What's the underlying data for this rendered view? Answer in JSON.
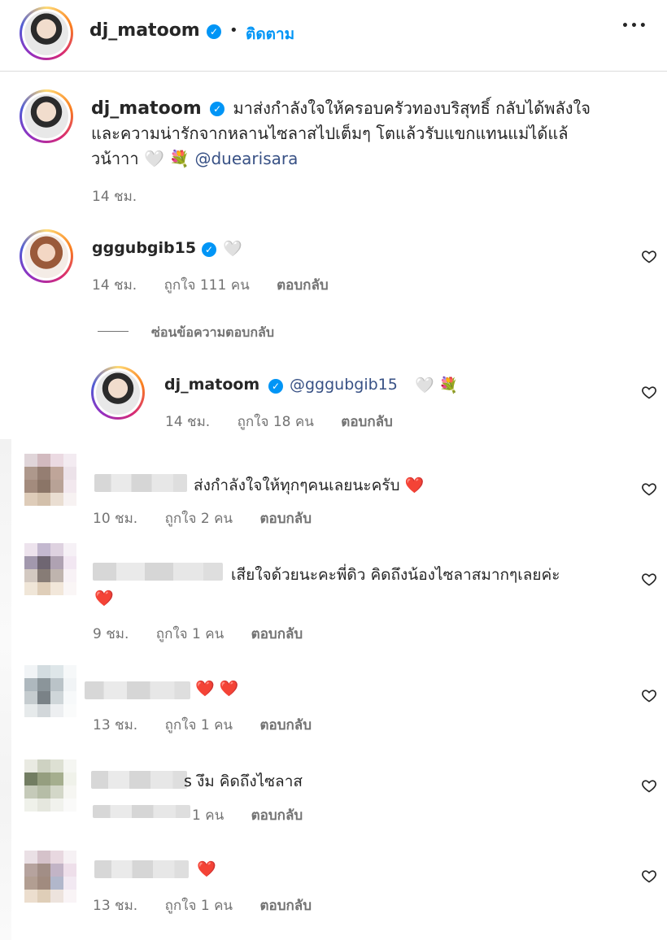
{
  "header": {
    "username": "dj_matoom",
    "follow_label": "ติดตาม",
    "separator": "•",
    "more_label": "•••"
  },
  "caption": {
    "username": "dj_matoom",
    "line1": "มาส่งกำลังใจให้ครอบครัวทองบริสุทธิ์ กลับได้พลังใจ",
    "line2": "และความน่ารักจากหลานไซลาสไปเต็มๆ โตแล้วรับแขกแทนแม่ได้แล้",
    "line3_text": "วน้าาา 🤍 💐",
    "line3_mention": "@duearisara",
    "time": "14 ชม."
  },
  "comments": [
    {
      "username": "gggubgib15",
      "text": "🤍",
      "time": "14 ชม.",
      "likes": "ถูกใจ 111 คน",
      "reply": "ตอบกลับ"
    }
  ],
  "hide_replies_label": "ซ่อนข้อความตอบกลับ",
  "reply_comment": {
    "username": "dj_matoom",
    "mention": "@gggubgib15",
    "text": "🤍 💐",
    "time": "14 ชม.",
    "likes": "ถูกใจ 18 คน",
    "reply": "ตอบกลับ"
  },
  "other_comments": [
    {
      "text": "ส่งกำลังใจให้ทุกๆคนเลยนะครับ ❤️",
      "time": "10 ชม.",
      "likes": "ถูกใจ 2 คน",
      "reply": "ตอบกลับ"
    },
    {
      "text": "เสียใจด้วยนะคะพี่ดิว คิดถึงน้องไซลาสมากๆเลยค่ะ",
      "text2": "❤️",
      "time": "9 ชม.",
      "likes": "ถูกใจ 1 คน",
      "reply": "ตอบกลับ"
    },
    {
      "text": "❤️ ❤️",
      "time": "13 ชม.",
      "likes": "ถูกใจ 1 คน",
      "reply": "ตอบกลับ"
    },
    {
      "text": "s งึม คิดถึงไซลาส",
      "likes": "1 คน",
      "reply": "ตอบกลับ"
    },
    {
      "text": "❤️",
      "time": "13 ชม.",
      "likes": "ถูกใจ 1 คน",
      "reply": "ตอบกลับ"
    }
  ],
  "colors": {
    "accent": "#0095f6",
    "text": "#262626",
    "secondary": "#737373",
    "heart": "#e0245e"
  }
}
